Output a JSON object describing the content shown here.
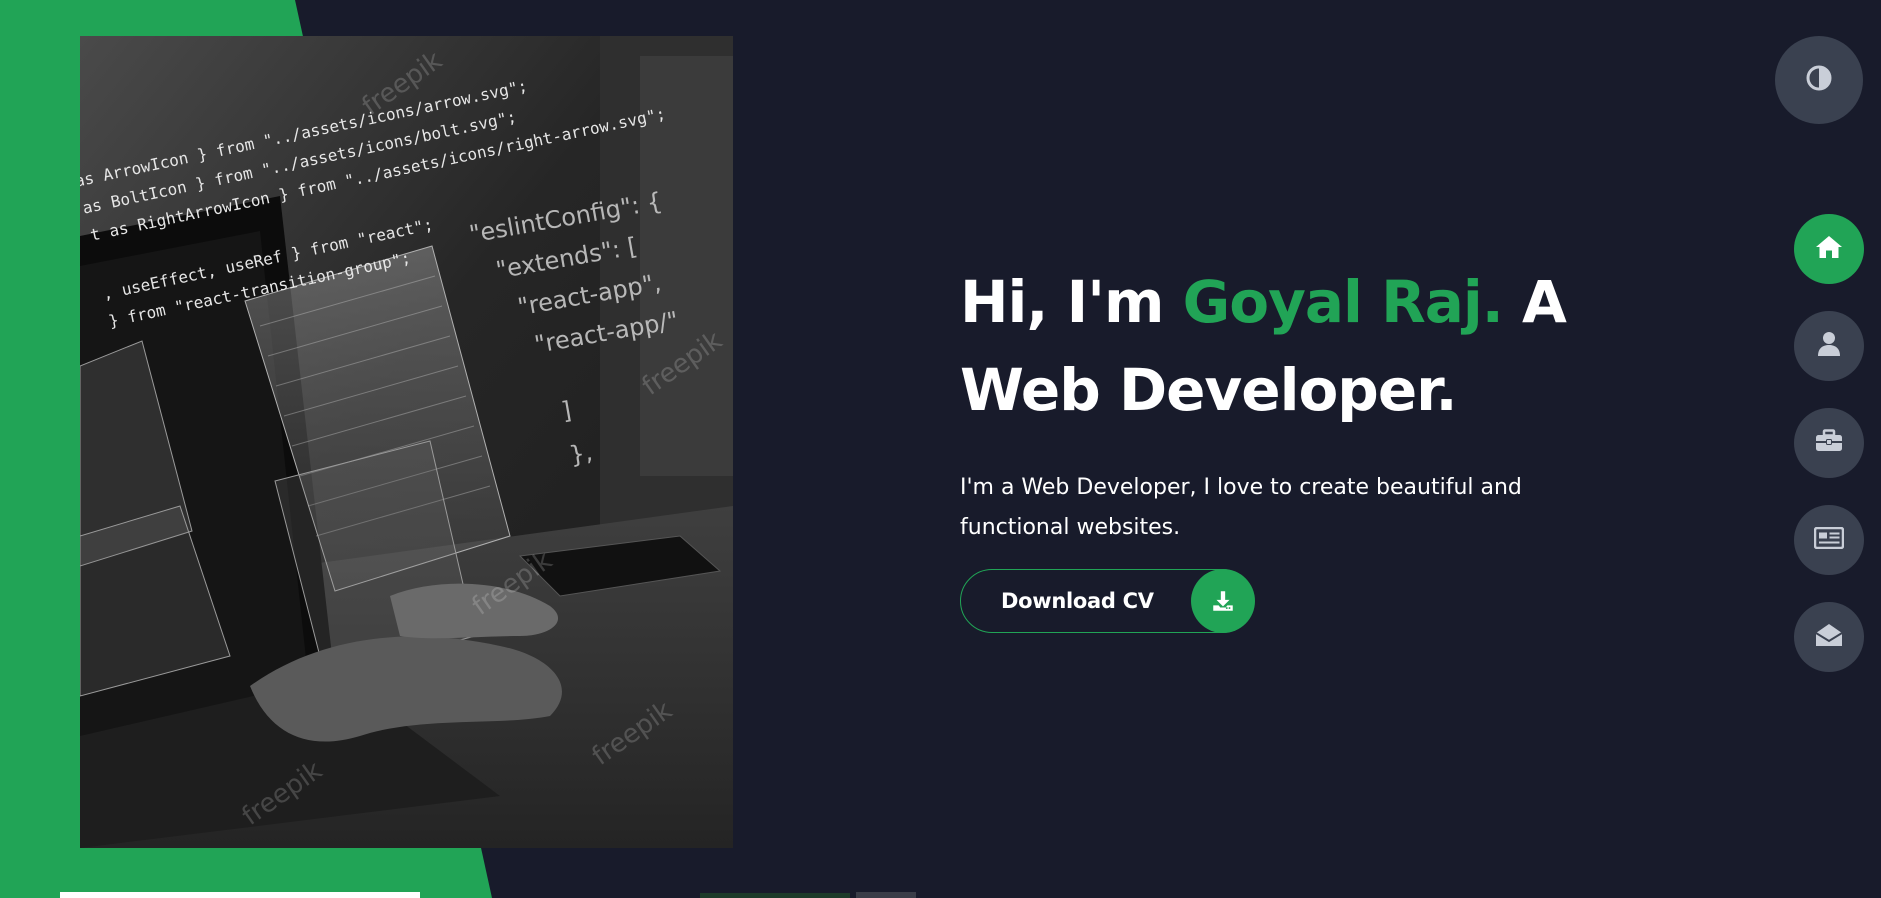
{
  "hero": {
    "greeting": "Hi, I'm ",
    "name": "Goyal Raj.",
    "role_prefix": " A",
    "role": "Web Developer.",
    "intro": "I'm a Web Developer, I love to create beautiful and functional websites.",
    "cta_label": "Download CV"
  },
  "image_text": {
    "code_lines": [
      "as ArrowIcon } from \"../assets/icons/arrow.svg\";",
      "as BoltIcon } from \"../assets/icons/bolt.svg\";",
      "t as RightArrowIcon } from \"../assets/icons/right-arrow.svg\";",
      ", useEffect, useRef } from \"react\";",
      "} from \"react-transition-group\";"
    ],
    "config_lines": [
      "\"eslintConfig\": {",
      "\"extends\": [",
      "\"react-app\",",
      "\"react-app/\"",
      "]",
      "},"
    ],
    "watermark": "freepik"
  },
  "nav": {
    "theme_toggle_icon": "contrast-icon",
    "items": [
      {
        "icon": "home-icon",
        "active": true
      },
      {
        "icon": "user-icon",
        "active": false
      },
      {
        "icon": "briefcase-icon",
        "active": false
      },
      {
        "icon": "newspaper-icon",
        "active": false
      },
      {
        "icon": "envelope-open-icon",
        "active": false
      }
    ]
  },
  "colors": {
    "accent": "#21a456",
    "background": "#181b2b",
    "button_grey": "#3a4150",
    "icon_light": "#c9ced8"
  }
}
